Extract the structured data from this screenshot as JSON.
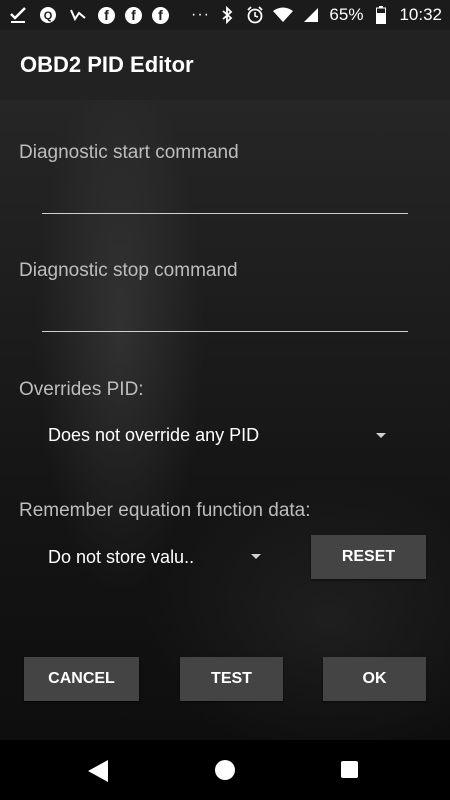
{
  "status_bar": {
    "battery_percent": "65%",
    "time": "10:32",
    "facebook_letter": "f",
    "overflow": "···"
  },
  "app_bar": {
    "title": "OBD2 PID Editor"
  },
  "form": {
    "start_command_label": "Diagnostic start command",
    "start_command_value": "",
    "stop_command_label": "Diagnostic stop command",
    "stop_command_value": "",
    "overrides_label": "Overrides PID:",
    "overrides_selected": "Does not override any PID",
    "remember_label": "Remember equation function data:",
    "remember_selected": "Do not store valu..",
    "reset_label": "RESET"
  },
  "actions": {
    "cancel_label": "CANCEL",
    "test_label": "TEST",
    "ok_label": "OK"
  },
  "colors": {
    "app_bar": "#222222",
    "button": "#444444",
    "label": "#bdbdbd"
  }
}
